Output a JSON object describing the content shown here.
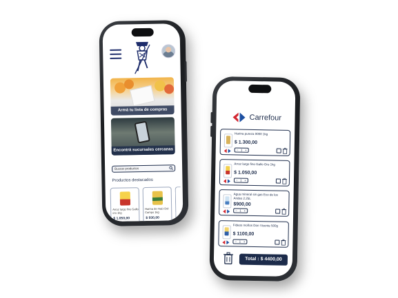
{
  "left_phone": {
    "menu_icon": "hamburger-menu-icon",
    "logo_icon": "character-logo-icon",
    "avatar_icon": "user-avatar",
    "cards": [
      {
        "label": "Armá tu lista de compras"
      },
      {
        "label": "Encontrá sucursales cercanas"
      }
    ],
    "search": {
      "placeholder": "Buscar productos",
      "icon": "search-icon"
    },
    "section_title": "Productos destacados",
    "products": [
      {
        "name": "Arroz largo fino Gallo oro 1kg",
        "price": "$ 1.050,00"
      },
      {
        "name": "Harina de maíz Del Campo 1kg",
        "price": "$ 930,00"
      }
    ]
  },
  "right_phone": {
    "store_name": "Carrefour",
    "brand_color": "#1c2b4a",
    "items": [
      {
        "name": "Harina pureza 0000 1kg",
        "price": "$ 1.300,00",
        "qty": "1",
        "minus": "−",
        "plus": "+"
      },
      {
        "name": "Arroz largo fino Gallo Oro 1kg",
        "price": "$ 1.050,00",
        "qty": "1",
        "minus": "−",
        "plus": "+"
      },
      {
        "name": "Agua mineral sin gas Eco de los Andes 2.25L",
        "price": "$900,00",
        "qty": "1",
        "minus": "−",
        "plus": "+"
      },
      {
        "name": "Fideos moños Don Vicente 500g",
        "price": "$ 1100,00",
        "qty": "1",
        "minus": "−",
        "plus": "+"
      }
    ],
    "total_label": "Total : $ 4400,00"
  }
}
